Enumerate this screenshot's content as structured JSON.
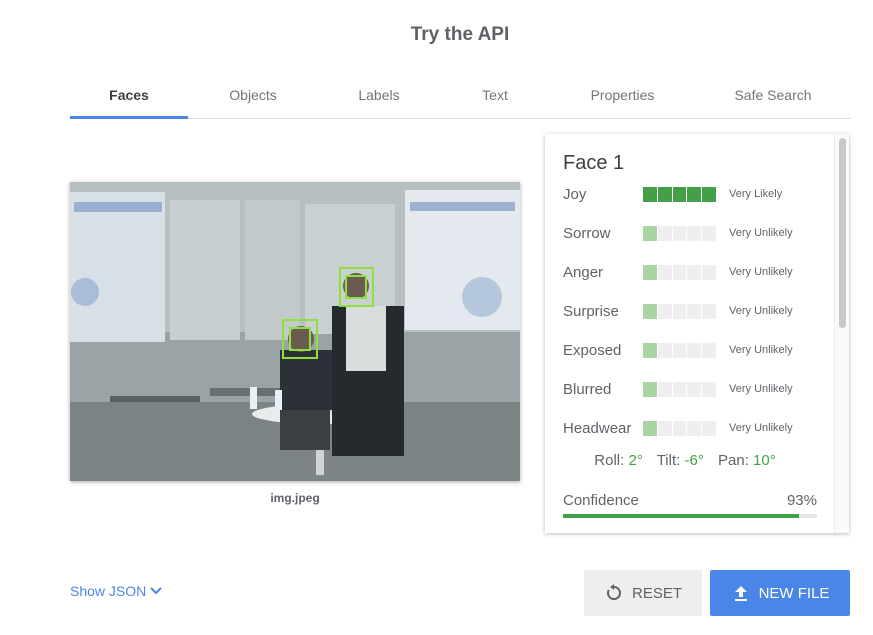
{
  "page": {
    "title": "Try the API"
  },
  "tabs": [
    {
      "label": "Faces"
    },
    {
      "label": "Objects"
    },
    {
      "label": "Labels"
    },
    {
      "label": "Text"
    },
    {
      "label": "Properties"
    },
    {
      "label": "Safe Search"
    }
  ],
  "image": {
    "caption": "img.jpeg",
    "alt": "Two people on a stage with faces detected"
  },
  "face": {
    "title": "Face 1",
    "attributes": [
      {
        "label": "Joy",
        "likelihood": "Very Likely",
        "level": 5
      },
      {
        "label": "Sorrow",
        "likelihood": "Very Unlikely",
        "level": 1
      },
      {
        "label": "Anger",
        "likelihood": "Very Unlikely",
        "level": 1
      },
      {
        "label": "Surprise",
        "likelihood": "Very Unlikely",
        "level": 1
      },
      {
        "label": "Exposed",
        "likelihood": "Very Unlikely",
        "level": 1
      },
      {
        "label": "Blurred",
        "likelihood": "Very Unlikely",
        "level": 1
      },
      {
        "label": "Headwear",
        "likelihood": "Very Unlikely",
        "level": 1
      }
    ],
    "roll_label": "Roll:",
    "roll": "2°",
    "tilt_label": "Tilt:",
    "tilt": "-6°",
    "pan_label": "Pan:",
    "pan": "10°",
    "confidence_label": "Confidence",
    "confidence": "93%",
    "confidence_value": 0.93
  },
  "footer": {
    "show_json": "Show JSON",
    "reset": "RESET",
    "new_file": "NEW FILE"
  },
  "colors": {
    "accent": "#4a86e8",
    "strong_green": "#43a047",
    "light_green": "#a8d5a2",
    "face_box": "#8ee03a"
  },
  "icons": {
    "show_json": "chevron-down-icon",
    "reset": "reset-icon",
    "new_file": "upload-icon"
  }
}
